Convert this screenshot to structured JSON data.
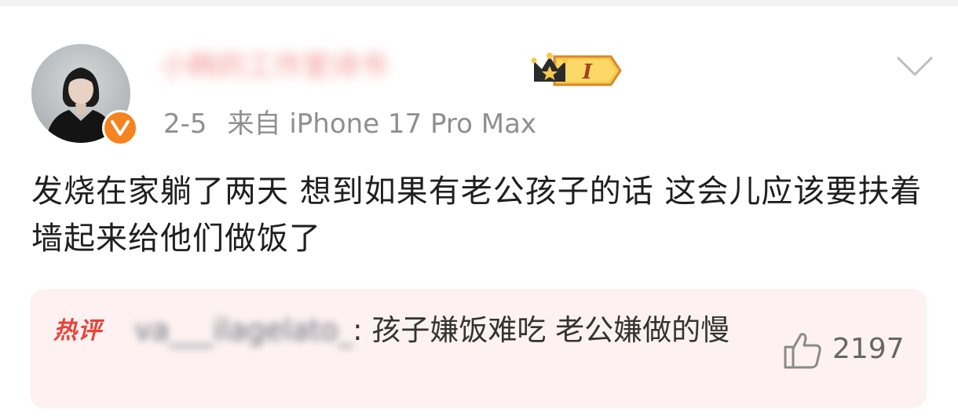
{
  "post": {
    "author_name": "小韩的工作室诗书",
    "date": "2-5",
    "source": "来自 iPhone 17 Pro Max",
    "text": "发烧在家躺了两天 想到如果有老公孩子的话 这会儿应该要扶着墙起来给他们做饭了",
    "member_level": "I"
  },
  "hot_comment": {
    "tag": "热评",
    "commenter": "va___ilagelato_",
    "separator": ":",
    "text": "孩子嫌饭难吃 老公嫌做的慢",
    "likes": "2197"
  },
  "icons": {
    "avatar": "user-avatar",
    "verified": "verified-v-icon",
    "crown": "crown-member-icon",
    "more": "chevron-down-icon",
    "like": "thumbs-up-icon"
  },
  "colors": {
    "verified_badge": "#f58320",
    "hot_tag": "#e9433a",
    "comment_bg": "#fdf2f1",
    "meta_text": "#8f8f8f",
    "member_badge": "#f7b52c"
  }
}
